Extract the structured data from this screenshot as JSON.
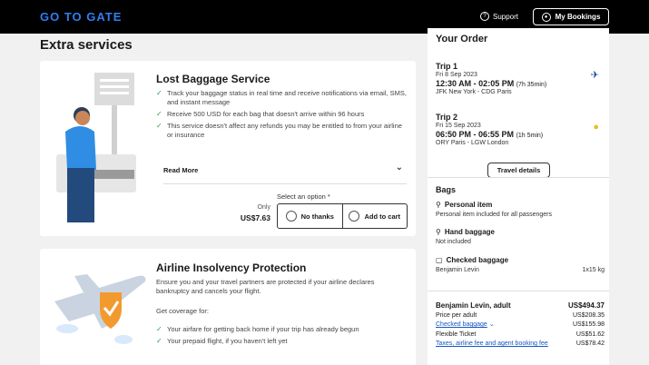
{
  "header": {
    "logo": "GO TO GATE",
    "support_label": "Support",
    "my_bookings_label": "My Bookings"
  },
  "main": {
    "section_title": "Extra services",
    "lost_baggage": {
      "title": "Lost Baggage Service",
      "bullets": [
        "Track your baggage status in real time and receive notifications via email, SMS, and instant message",
        "Receive 500 USD for each bag that doesn't arrive within 96 hours",
        "This service doesn't affect any refunds you may be entitled to from your airline or insurance"
      ],
      "read_more": "Read More",
      "only_label": "Only",
      "price": "US$7.63",
      "select_label": "Select an option *",
      "option_no": "No thanks",
      "option_add": "Add to cart"
    },
    "insolvency": {
      "title": "Airline Insolvency Protection",
      "description": "Ensure you and your travel partners are protected if your airline declares bankruptcy and cancels your flight.",
      "coverage_label": "Get coverage for:",
      "bullets": [
        "Your airfare for getting back home if your trip has already begun",
        "Your prepaid flight, if you haven't left yet"
      ]
    }
  },
  "order": {
    "title": "Your Order",
    "trips": [
      {
        "name": "Trip 1",
        "date": "Fri 8 Sep 2023",
        "time": "12:30 AM - 02:05 PM",
        "duration": "(7h 35min)",
        "route": "JFK New York - CDG Paris"
      },
      {
        "name": "Trip 2",
        "date": "Fri 15 Sep 2023",
        "time": "06:50 PM - 06:55 PM",
        "duration": "(1h 5min)",
        "route": "ORY Paris - LGW London"
      }
    ],
    "travel_details": "Travel details",
    "bags_title": "Bags",
    "bags": [
      {
        "name": "Personal item",
        "desc": "Personal item included for all passengers",
        "qty": ""
      },
      {
        "name": "Hand baggage",
        "desc": "Not included",
        "qty": ""
      },
      {
        "name": "Checked baggage",
        "desc": "Benjamin Levin",
        "qty": "1x15 kg"
      }
    ],
    "passenger": {
      "name": "Benjamin Levin, adult",
      "total": "US$494.37",
      "lines": [
        {
          "label": "Price per adult",
          "value": "US$208.35"
        },
        {
          "label": "Checked baggage",
          "value": "US$155.98"
        },
        {
          "label": "Flexible Ticket",
          "value": "US$51.62"
        },
        {
          "label": "Taxes, airline fee and agent booking fee",
          "value": "US$78.42"
        }
      ]
    }
  },
  "colors": {
    "brand": "#2f7ff2",
    "check": "#2e9e4a",
    "link": "#1558c0"
  }
}
